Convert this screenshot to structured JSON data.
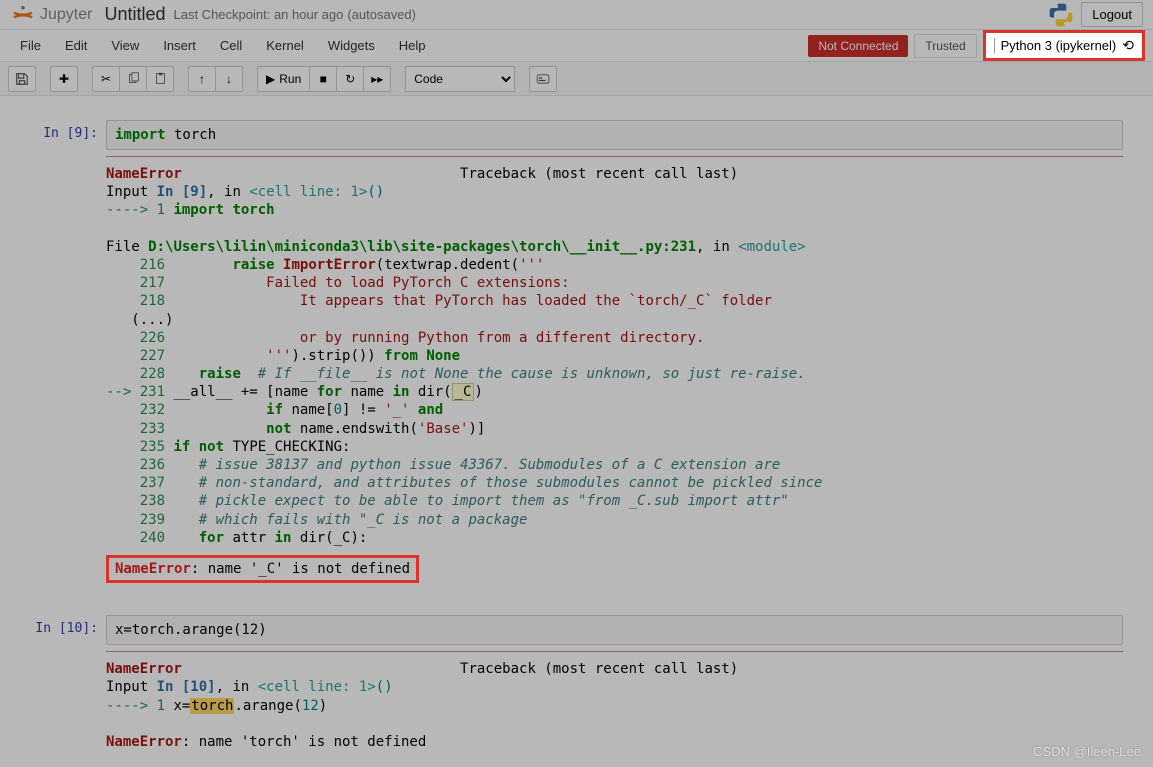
{
  "header": {
    "logo_text": "Jupyter",
    "title": "Untitled",
    "checkpoint": "Last Checkpoint: an hour ago",
    "autosaved": "(autosaved)",
    "logout": "Logout"
  },
  "menubar": {
    "items": [
      "File",
      "Edit",
      "View",
      "Insert",
      "Cell",
      "Kernel",
      "Widgets",
      "Help"
    ],
    "not_connected": "Not Connected",
    "trusted": "Trusted",
    "kernel": "Python 3 (ipykernel)"
  },
  "toolbar": {
    "run_label": "Run",
    "cell_type": "Code"
  },
  "cells": [
    {
      "prompt": "In  [9]:",
      "code_kw": "import",
      "code_rest": " torch",
      "error": {
        "name": "NameError",
        "traceback_label": "Traceback (most recent call last)",
        "input_label": "Input ",
        "in_ref": "In [9]",
        "in_suffix": ", in ",
        "cell_line": "<cell line: 1>",
        "parens": "()",
        "arrow1": "----> 1 ",
        "line1_kw": "import",
        "line1_rest": " torch",
        "file_prefix": "File ",
        "file_path": "D:\\Users\\lilin\\miniconda3\\lib\\site-packages\\torch\\__init__.py:231",
        "file_suffix": ", in ",
        "module": "<module>",
        "lines": [
          {
            "no": "216",
            "indent": "        ",
            "kw": "raise",
            "rest1": " ",
            "cls": "ImportError",
            "rest2": "(textwrap.dedent(",
            "str": "'''"
          },
          {
            "no": "217",
            "text": "            Failed to load PyTorch C extensions:",
            "str": true
          },
          {
            "no": "218",
            "text": "                It appears that PyTorch has loaded the `torch/_C` folder",
            "str": true
          },
          {
            "no": "",
            "text": "(...)",
            "plain": true
          },
          {
            "no": "226",
            "text": "                or by running Python from a different directory.",
            "str": true
          },
          {
            "no": "227",
            "text": "            '''",
            "close": ").strip()) ",
            "kw": "from",
            "none": " None"
          },
          {
            "no": "228",
            "indent": "    ",
            "kw": "raise",
            "comment": "  # If __file__ is not None the cause is unknown, so just re-raise."
          }
        ],
        "arrow231": "--> 231",
        "line231_a": " __all__ += [name ",
        "line231_for": "for",
        "line231_b": " name ",
        "line231_in": "in",
        "line231_c": " dir(",
        "line231_hl": "_C",
        "line231_d": ")",
        "lines2": [
          {
            "no": "232",
            "text": "            ",
            "kw": "if",
            "rest": " name[",
            "num": "0",
            "rest2": "] != ",
            "str": "'_'",
            "kw2": " and"
          },
          {
            "no": "233",
            "text": "            ",
            "kw": "not",
            "rest": " name.endswith(",
            "str": "'Base'",
            "rest2": ")]"
          },
          {
            "no": "235",
            "kw": "if",
            "kw2": " not",
            "rest": " TYPE_CHECKING:"
          },
          {
            "no": "236",
            "comment": "    # issue 38137 and python issue 43367. Submodules of a C extension are"
          },
          {
            "no": "237",
            "comment": "    # non-standard, and attributes of those submodules cannot be pickled since"
          },
          {
            "no": "238",
            "comment": "    # pickle expect to be able to import them as \"from _C.sub import attr\""
          },
          {
            "no": "239",
            "comment": "    # which fails with \"_C is not a package"
          },
          {
            "no": "240",
            "text": "    ",
            "kw": "for",
            "rest": " attr ",
            "kw2": "in",
            "rest2": " dir(_C):"
          }
        ],
        "final_name": "NameError",
        "final_msg": ": name '_C' is not defined"
      }
    },
    {
      "prompt": "In [10]:",
      "code": "x=torch.arange(12)",
      "error": {
        "name": "NameError",
        "traceback_label": "Traceback (most recent call last)",
        "input_label": "Input ",
        "in_ref": "In [10]",
        "in_suffix": ", in ",
        "cell_line": "<cell line: 1>",
        "parens": "()",
        "arrow1": "----> 1 ",
        "line1_pre": "x=",
        "line1_hl": "torch",
        "line1_post": ".arange(",
        "line1_num": "12",
        "line1_end": ")",
        "final_name": "NameError",
        "final_msg": ": name 'torch' is not defined"
      }
    }
  ],
  "watermark": "CSDN @Ileen-Lee"
}
